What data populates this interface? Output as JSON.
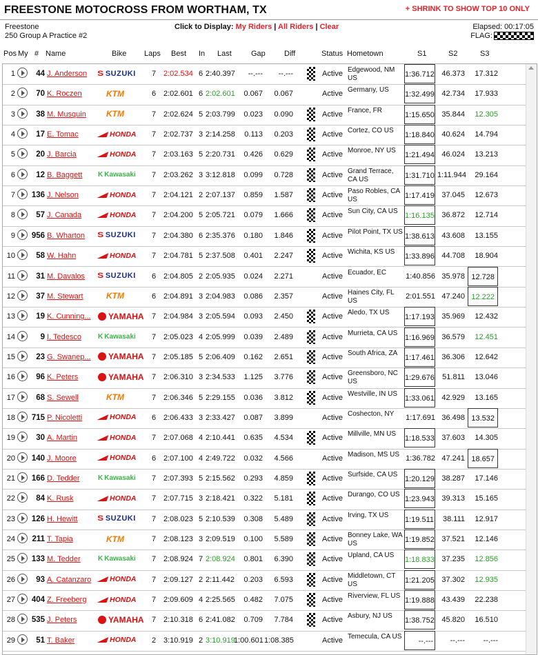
{
  "title": "FREESTONE MOTOCROSS FROM WORTHAM, TX",
  "shrink_label": "+ SHRINK TO SHOW TOP 10 ONLY",
  "venue": "Freestone",
  "session": "250 Group A Practice #2",
  "display": {
    "label": "Click to Display:",
    "my_riders": "My Riders",
    "sep": "|",
    "all_riders": "All Riders",
    "clear": "Clear"
  },
  "elapsed": "Elapsed: 00:17:05",
  "flag_label": "FLAG:",
  "columns": {
    "pos": "Pos",
    "my": "My",
    "num": "#",
    "name": "Name",
    "bike": "Bike",
    "laps": "Laps",
    "best": "Best",
    "in": "In",
    "last": "Last",
    "gap": "Gap",
    "diff": "Diff",
    "status": "Status",
    "hometown": "Hometown",
    "s1": "S1",
    "s2": "S2",
    "s3": "S3"
  },
  "colors": {
    "accent": "#e0242b",
    "fast": "#2a9d2a",
    "best": "#d11111"
  },
  "rows": [
    {
      "pos": "1",
      "num": "44",
      "name": "J. Anderson",
      "bike": "SUZUKI",
      "laps": "7",
      "best": "2:02.534",
      "best_c": "red",
      "in": "6",
      "last": "2:40.397",
      "last_c": "",
      "gap": "--.---",
      "diff": "--.---",
      "status": "Active",
      "flag": true,
      "home": "Edgewood, NM US",
      "s1": "1:36.712",
      "s1b": true,
      "s1c": "",
      "s2": "46.373",
      "s2c": "",
      "s3": "17.312",
      "s3b": false,
      "s3c": ""
    },
    {
      "pos": "2",
      "num": "70",
      "name": "K. Roczen",
      "bike": "KTM",
      "laps": "6",
      "best": "2:02.601",
      "best_c": "",
      "in": "6",
      "last": "2:02.601",
      "last_c": "green",
      "gap": "0.067",
      "diff": "0.067",
      "status": "Active",
      "flag": false,
      "home": "Germany, US",
      "s1": "1:32.499",
      "s1b": true,
      "s1c": "",
      "s2": "42.734",
      "s2c": "",
      "s3": "17.933",
      "s3b": false,
      "s3c": ""
    },
    {
      "pos": "3",
      "num": "38",
      "name": "M. Musquin",
      "bike": "KTM",
      "laps": "7",
      "best": "2:02.624",
      "best_c": "",
      "in": "5",
      "last": "2:03.799",
      "last_c": "",
      "gap": "0.023",
      "diff": "0.090",
      "status": "Active",
      "flag": true,
      "home": "France, FR",
      "s1": "1:15.650",
      "s1b": true,
      "s1c": "",
      "s2": "35.844",
      "s2c": "",
      "s3": "12.305",
      "s3b": false,
      "s3c": "green"
    },
    {
      "pos": "4",
      "num": "17",
      "name": "E. Tomac",
      "bike": "HONDA",
      "laps": "7",
      "best": "2:02.737",
      "best_c": "",
      "in": "3",
      "last": "2:14.258",
      "last_c": "",
      "gap": "0.113",
      "diff": "0.203",
      "status": "Active",
      "flag": true,
      "home": "Cortez, CO US",
      "s1": "1:18.840",
      "s1b": true,
      "s1c": "",
      "s2": "40.624",
      "s2c": "",
      "s3": "14.794",
      "s3b": false,
      "s3c": ""
    },
    {
      "pos": "5",
      "num": "20",
      "name": "J. Barcia",
      "bike": "HONDA",
      "laps": "7",
      "best": "2:03.163",
      "best_c": "",
      "in": "5",
      "last": "2:20.731",
      "last_c": "",
      "gap": "0.426",
      "diff": "0.629",
      "status": "Active",
      "flag": true,
      "home": "Monroe, NY US",
      "s1": "1:21.494",
      "s1b": true,
      "s1c": "",
      "s2": "46.024",
      "s2c": "",
      "s3": "13.213",
      "s3b": false,
      "s3c": ""
    },
    {
      "pos": "6",
      "num": "12",
      "name": "B. Baggett",
      "bike": "KAWASAKI",
      "laps": "7",
      "best": "2:03.262",
      "best_c": "",
      "in": "3",
      "last": "3:12.818",
      "last_c": "",
      "gap": "0.099",
      "diff": "0.728",
      "status": "Active",
      "flag": true,
      "home": "Grand Terrace, CA US",
      "s1": "1:31.710",
      "s1b": true,
      "s1c": "",
      "s2": "1:11.944",
      "s2c": "",
      "s3": "29.164",
      "s3b": false,
      "s3c": ""
    },
    {
      "pos": "7",
      "num": "136",
      "name": "J. Nelson",
      "bike": "HONDA",
      "laps": "7",
      "best": "2:04.121",
      "best_c": "",
      "in": "2",
      "last": "2:07.137",
      "last_c": "",
      "gap": "0.859",
      "diff": "1.587",
      "status": "Active",
      "flag": true,
      "home": "Paso Robles, CA US",
      "s1": "1:17.419",
      "s1b": true,
      "s1c": "",
      "s2": "37.045",
      "s2c": "",
      "s3": "12.673",
      "s3b": false,
      "s3c": ""
    },
    {
      "pos": "8",
      "num": "57",
      "name": "J. Canada",
      "bike": "HONDA",
      "laps": "7",
      "best": "2:04.200",
      "best_c": "",
      "in": "5",
      "last": "2:05.721",
      "last_c": "",
      "gap": "0.079",
      "diff": "1.666",
      "status": "Active",
      "flag": true,
      "home": "Sun City, CA US",
      "s1": "1:16.135",
      "s1b": true,
      "s1c": "green",
      "s2": "36.872",
      "s2c": "",
      "s3": "12.714",
      "s3b": false,
      "s3c": ""
    },
    {
      "pos": "9",
      "num": "956",
      "name": "B. Wharton",
      "bike": "SUZUKI",
      "laps": "7",
      "best": "2:04.380",
      "best_c": "",
      "in": "6",
      "last": "2:35.376",
      "last_c": "",
      "gap": "0.180",
      "diff": "1.846",
      "status": "Active",
      "flag": true,
      "home": "Pilot Point, TX US",
      "s1": "1:38.613",
      "s1b": true,
      "s1c": "",
      "s2": "43.608",
      "s2c": "",
      "s3": "13.155",
      "s3b": false,
      "s3c": ""
    },
    {
      "pos": "10",
      "num": "58",
      "name": "W. Hahn",
      "bike": "HONDA",
      "laps": "7",
      "best": "2:04.781",
      "best_c": "",
      "in": "5",
      "last": "2:37.508",
      "last_c": "",
      "gap": "0.401",
      "diff": "2.247",
      "status": "Active",
      "flag": true,
      "home": "Wichita, KS US",
      "s1": "1:33.896",
      "s1b": true,
      "s1c": "",
      "s2": "44.708",
      "s2c": "",
      "s3": "18.904",
      "s3b": false,
      "s3c": ""
    },
    {
      "pos": "11",
      "num": "31",
      "name": "M. Davalos",
      "bike": "SUZUKI",
      "laps": "6",
      "best": "2:04.805",
      "best_c": "",
      "in": "2",
      "last": "2:05.935",
      "last_c": "",
      "gap": "0.024",
      "diff": "2.271",
      "status": "Active",
      "flag": false,
      "home": "Ecuador, EC",
      "s1": "1:40.856",
      "s1b": false,
      "s1c": "",
      "s2": "35.978",
      "s2c": "",
      "s3": "12.728",
      "s3b": true,
      "s3c": ""
    },
    {
      "pos": "12",
      "num": "37",
      "name": "M. Stewart",
      "bike": "KTM",
      "laps": "6",
      "best": "2:04.891",
      "best_c": "",
      "in": "3",
      "last": "2:04.983",
      "last_c": "",
      "gap": "0.086",
      "diff": "2.357",
      "status": "Active",
      "flag": false,
      "home": "Haines City, FL US",
      "s1": "2:01.551",
      "s1b": false,
      "s1c": "",
      "s2": "47.240",
      "s2c": "",
      "s3": "12.222",
      "s3b": true,
      "s3c": "green"
    },
    {
      "pos": "13",
      "num": "19",
      "name": "K. Cunning...",
      "bike": "YAMAHA",
      "laps": "7",
      "best": "2:04.984",
      "best_c": "",
      "in": "3",
      "last": "2:05.594",
      "last_c": "",
      "gap": "0.093",
      "diff": "2.450",
      "status": "Active",
      "flag": true,
      "home": "Aledo, TX US",
      "s1": "1:17.193",
      "s1b": true,
      "s1c": "",
      "s2": "35.969",
      "s2c": "",
      "s3": "12.432",
      "s3b": false,
      "s3c": ""
    },
    {
      "pos": "14",
      "num": "9",
      "name": "I. Tedesco",
      "bike": "KAWASAKI",
      "laps": "7",
      "best": "2:05.023",
      "best_c": "",
      "in": "4",
      "last": "2:05.999",
      "last_c": "",
      "gap": "0.039",
      "diff": "2.489",
      "status": "Active",
      "flag": true,
      "home": "Murrieta, CA US",
      "s1": "1:16.969",
      "s1b": true,
      "s1c": "",
      "s2": "36.579",
      "s2c": "",
      "s3": "12.451",
      "s3b": false,
      "s3c": "green"
    },
    {
      "pos": "15",
      "num": "23",
      "name": "G. Swanep...",
      "bike": "YAMAHA",
      "laps": "7",
      "best": "2:05.185",
      "best_c": "",
      "in": "5",
      "last": "2:06.409",
      "last_c": "",
      "gap": "0.162",
      "diff": "2.651",
      "status": "Active",
      "flag": true,
      "home": "South Africa, ZA",
      "s1": "1:17.461",
      "s1b": true,
      "s1c": "",
      "s2": "36.306",
      "s2c": "",
      "s3": "12.642",
      "s3b": false,
      "s3c": ""
    },
    {
      "pos": "16",
      "num": "96",
      "name": "K. Peters",
      "bike": "YAMAHA",
      "laps": "7",
      "best": "2:06.310",
      "best_c": "",
      "in": "3",
      "last": "2:34.533",
      "last_c": "",
      "gap": "1.125",
      "diff": "3.776",
      "status": "Active",
      "flag": true,
      "home": "Greensboro, NC US",
      "s1": "1:29.676",
      "s1b": true,
      "s1c": "",
      "s2": "51.811",
      "s2c": "",
      "s3": "13.046",
      "s3b": false,
      "s3c": ""
    },
    {
      "pos": "17",
      "num": "68",
      "name": "S. Sewell",
      "bike": "KTM",
      "laps": "7",
      "best": "2:06.346",
      "best_c": "",
      "in": "5",
      "last": "2:29.155",
      "last_c": "",
      "gap": "0.036",
      "diff": "3.812",
      "status": "Active",
      "flag": true,
      "home": "Westville, IN US",
      "s1": "1:33.061",
      "s1b": true,
      "s1c": "",
      "s2": "42.929",
      "s2c": "",
      "s3": "13.165",
      "s3b": false,
      "s3c": ""
    },
    {
      "pos": "18",
      "num": "715",
      "name": "P. Nicoletti",
      "bike": "HONDA",
      "laps": "6",
      "best": "2:06.433",
      "best_c": "",
      "in": "3",
      "last": "2:33.427",
      "last_c": "",
      "gap": "0.087",
      "diff": "3.899",
      "status": "Active",
      "flag": false,
      "home": "Coshecton, NY",
      "s1": "1:17.691",
      "s1b": false,
      "s1c": "",
      "s2": "36.498",
      "s2c": "",
      "s3": "13.532",
      "s3b": true,
      "s3c": ""
    },
    {
      "pos": "19",
      "num": "30",
      "name": "A. Martin",
      "bike": "HONDA",
      "laps": "7",
      "best": "2:07.068",
      "best_c": "",
      "in": "4",
      "last": "2:10.441",
      "last_c": "",
      "gap": "0.635",
      "diff": "4.534",
      "status": "Active",
      "flag": true,
      "home": "Millville, MN US",
      "s1": "1:18.533",
      "s1b": true,
      "s1c": "",
      "s2": "37.603",
      "s2c": "",
      "s3": "14.305",
      "s3b": false,
      "s3c": ""
    },
    {
      "pos": "20",
      "num": "140",
      "name": "J. Moore",
      "bike": "HONDA",
      "laps": "6",
      "best": "2:07.100",
      "best_c": "",
      "in": "4",
      "last": "2:49.722",
      "last_c": "",
      "gap": "0.032",
      "diff": "4.566",
      "status": "Active",
      "flag": false,
      "home": "Madison, MS US",
      "s1": "1:36.782",
      "s1b": false,
      "s1c": "",
      "s2": "47.241",
      "s2c": "",
      "s3": "18.657",
      "s3b": true,
      "s3c": ""
    },
    {
      "pos": "21",
      "num": "166",
      "name": "D. Tedder",
      "bike": "KAWASAKI",
      "laps": "7",
      "best": "2:07.393",
      "best_c": "",
      "in": "5",
      "last": "2:15.562",
      "last_c": "",
      "gap": "0.293",
      "diff": "4.859",
      "status": "Active",
      "flag": true,
      "home": "Surfside, CA US",
      "s1": "1:20.129",
      "s1b": true,
      "s1c": "",
      "s2": "38.287",
      "s2c": "",
      "s3": "17.146",
      "s3b": false,
      "s3c": ""
    },
    {
      "pos": "22",
      "num": "84",
      "name": "K. Rusk",
      "bike": "HONDA",
      "laps": "7",
      "best": "2:07.715",
      "best_c": "",
      "in": "3",
      "last": "2:18.421",
      "last_c": "",
      "gap": "0.322",
      "diff": "5.181",
      "status": "Active",
      "flag": true,
      "home": "Durango, CO US",
      "s1": "1:23.943",
      "s1b": true,
      "s1c": "",
      "s2": "39.313",
      "s2c": "",
      "s3": "15.165",
      "s3b": false,
      "s3c": ""
    },
    {
      "pos": "23",
      "num": "126",
      "name": "H. Hewitt",
      "bike": "SUZUKI",
      "laps": "7",
      "best": "2:08.023",
      "best_c": "",
      "in": "5",
      "last": "2:10.539",
      "last_c": "",
      "gap": "0.308",
      "diff": "5.489",
      "status": "Active",
      "flag": true,
      "home": "Irving, TX US",
      "s1": "1:19.511",
      "s1b": true,
      "s1c": "",
      "s2": "38.111",
      "s2c": "",
      "s3": "12.917",
      "s3b": false,
      "s3c": ""
    },
    {
      "pos": "24",
      "num": "211",
      "name": "T. Tapia",
      "bike": "KTM",
      "laps": "7",
      "best": "2:08.123",
      "best_c": "",
      "in": "3",
      "last": "2:09.519",
      "last_c": "",
      "gap": "0.100",
      "diff": "5.589",
      "status": "Active",
      "flag": true,
      "home": "Bonney Lake, WA US",
      "s1": "1:19.852",
      "s1b": true,
      "s1c": "",
      "s2": "37.521",
      "s2c": "",
      "s3": "12.146",
      "s3b": false,
      "s3c": ""
    },
    {
      "pos": "25",
      "num": "133",
      "name": "M. Tedder",
      "bike": "KAWASAKI",
      "laps": "7",
      "best": "2:08.924",
      "best_c": "",
      "in": "7",
      "last": "2:08.924",
      "last_c": "green",
      "gap": "0.801",
      "diff": "6.390",
      "status": "Active",
      "flag": true,
      "home": "Upland, CA US",
      "s1": "1:18.833",
      "s1b": true,
      "s1c": "green",
      "s2": "37.235",
      "s2c": "",
      "s3": "12.856",
      "s3b": false,
      "s3c": "green"
    },
    {
      "pos": "26",
      "num": "93",
      "name": "A. Catanzaro",
      "bike": "HONDA",
      "laps": "7",
      "best": "2:09.127",
      "best_c": "",
      "in": "2",
      "last": "2:11.442",
      "last_c": "",
      "gap": "0.203",
      "diff": "6.593",
      "status": "Active",
      "flag": true,
      "home": "Middletown, CT US",
      "s1": "1:21.205",
      "s1b": true,
      "s1c": "",
      "s2": "37.302",
      "s2c": "",
      "s3": "12.935",
      "s3b": false,
      "s3c": "green"
    },
    {
      "pos": "27",
      "num": "404",
      "name": "Z. Freeberg",
      "bike": "HONDA",
      "laps": "7",
      "best": "2:09.609",
      "best_c": "",
      "in": "4",
      "last": "2:25.565",
      "last_c": "",
      "gap": "0.482",
      "diff": "7.075",
      "status": "Active",
      "flag": true,
      "home": "Riverview, FL US",
      "s1": "1:19.888",
      "s1b": true,
      "s1c": "",
      "s2": "43.439",
      "s2c": "",
      "s3": "22.238",
      "s3b": false,
      "s3c": ""
    },
    {
      "pos": "28",
      "num": "535",
      "name": "J. Peters",
      "bike": "YAMAHA",
      "laps": "7",
      "best": "2:10.318",
      "best_c": "",
      "in": "6",
      "last": "2:41.082",
      "last_c": "",
      "gap": "0.709",
      "diff": "7.784",
      "status": "Active",
      "flag": true,
      "home": "Asbury, NJ US",
      "s1": "1:38.752",
      "s1b": true,
      "s1c": "",
      "s2": "45.820",
      "s2c": "",
      "s3": "16.510",
      "s3b": false,
      "s3c": ""
    },
    {
      "pos": "29",
      "num": "51",
      "name": "T. Baker",
      "bike": "HONDA",
      "laps": "2",
      "best": "3:10.919",
      "best_c": "",
      "in": "2",
      "last": "3:10.919",
      "last_c": "green",
      "gap": "1:00.601",
      "diff": "1:08.385",
      "status": "Active",
      "flag": false,
      "home": "Temecula, CA US",
      "s1": "--.---",
      "s1b": true,
      "s1c": "",
      "s2": "--.---",
      "s2c": "",
      "s3": "--.---",
      "s3b": false,
      "s3c": ""
    }
  ]
}
